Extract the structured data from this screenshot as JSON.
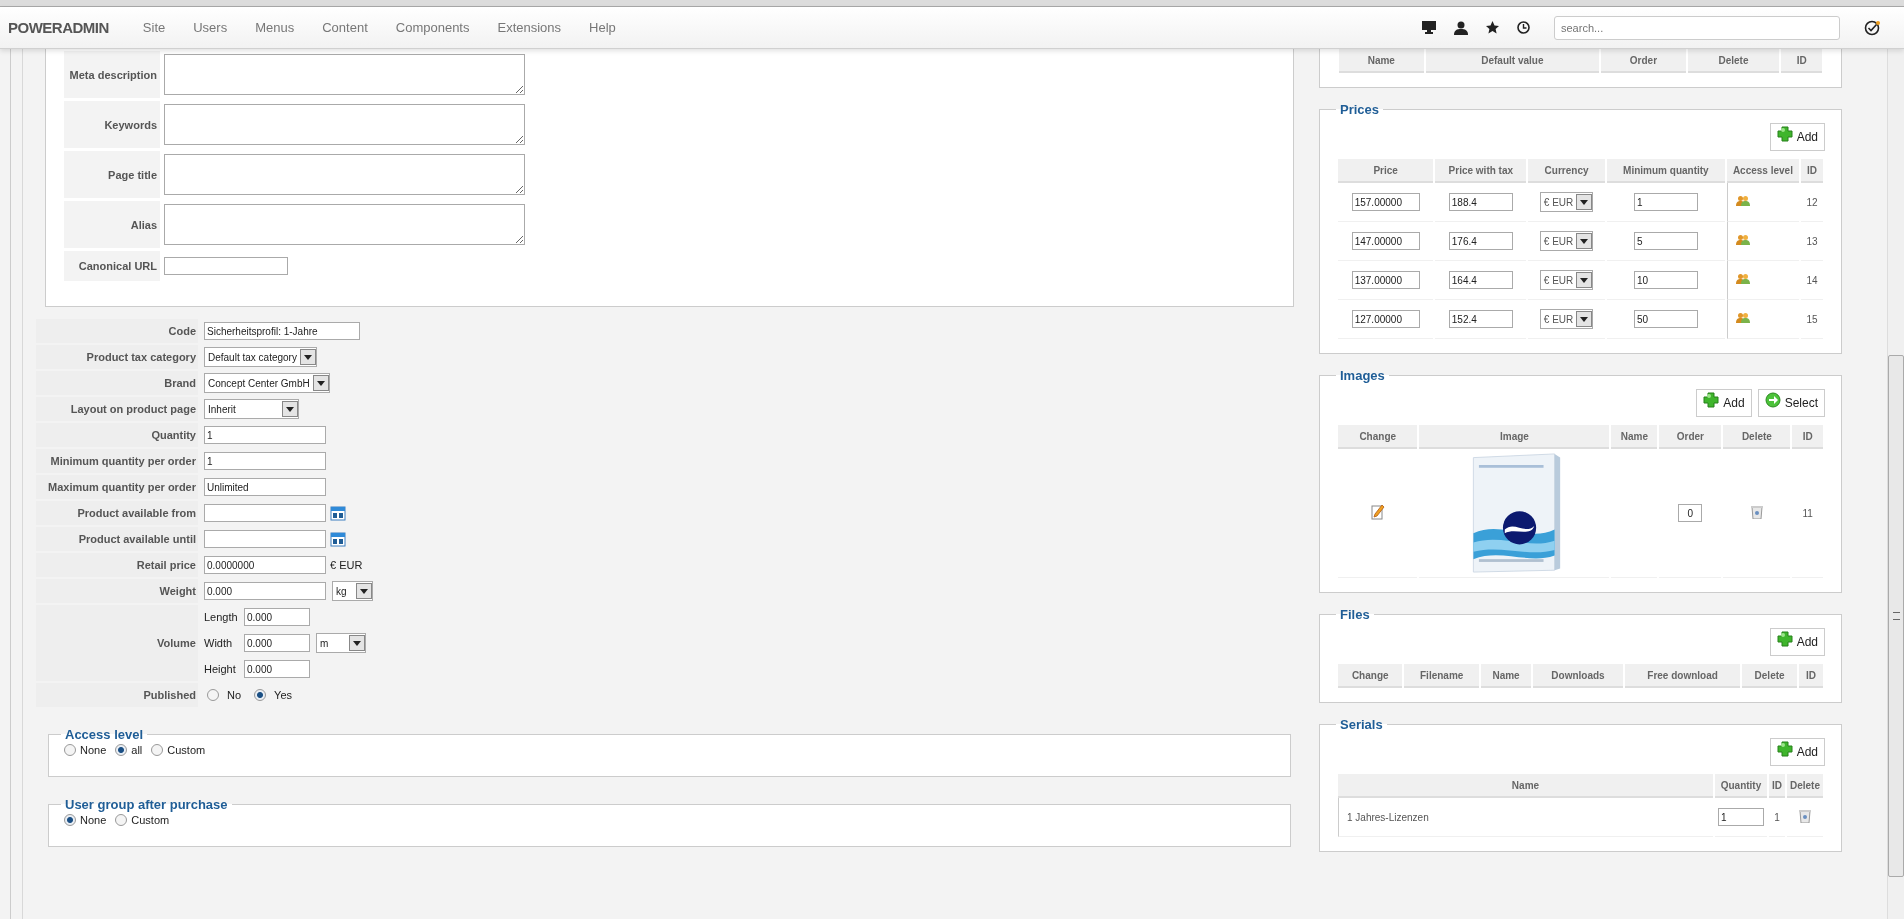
{
  "navbar": {
    "logo": "POWERADMIN",
    "menu": [
      "Site",
      "Users",
      "Menus",
      "Content",
      "Components",
      "Extensions",
      "Help"
    ],
    "search": {
      "placeholder": "search..."
    }
  },
  "meta_fields": [
    {
      "label": "Meta description",
      "kind": "textarea"
    },
    {
      "label": "Keywords",
      "kind": "textarea"
    },
    {
      "label": "Page title",
      "kind": "textarea"
    },
    {
      "label": "Alias",
      "kind": "textarea"
    },
    {
      "label": "Canonical URL",
      "kind": "text"
    }
  ],
  "product_fields": [
    {
      "label": "Code",
      "kind": "text",
      "value": "Sicherheitsprofil: 1-Jahre"
    },
    {
      "label": "Product tax category",
      "kind": "select",
      "value": "Default tax category"
    },
    {
      "label": "Brand",
      "kind": "select",
      "value": "Concept Center GmbH"
    },
    {
      "label": "Layout on product page",
      "kind": "select",
      "value": "Inherit"
    },
    {
      "label": "Quantity",
      "kind": "text",
      "value": "1"
    },
    {
      "label": "Minimum quantity per order",
      "kind": "text",
      "value": "1"
    },
    {
      "label": "Maximum quantity per order",
      "kind": "text",
      "value": "Unlimited"
    },
    {
      "label": "Product available from",
      "kind": "date"
    },
    {
      "label": "Product available until",
      "kind": "date"
    },
    {
      "label": "Retail price",
      "kind": "text",
      "value": "0.0000000",
      "suffix": "€ EUR"
    },
    {
      "label": "Weight",
      "kind": "text",
      "value": "0.000",
      "unit": "kg"
    },
    {
      "label": "Volume",
      "kind": "volume",
      "dims": [
        {
          "label": "Length",
          "value": "0.000"
        },
        {
          "label": "Width",
          "value": "0.000"
        },
        {
          "label": "Height",
          "value": "0.000"
        }
      ],
      "unit": "m"
    },
    {
      "label": "Published",
      "kind": "radio",
      "options": [
        {
          "label": "No",
          "selected": false
        },
        {
          "label": "Yes",
          "selected": true
        }
      ]
    }
  ],
  "access_level": {
    "title": "Access level",
    "options": [
      {
        "label": "None",
        "selected": false
      },
      {
        "label": "all",
        "selected": true
      },
      {
        "label": "Custom",
        "selected": false
      }
    ]
  },
  "user_group": {
    "title": "User group after purchase",
    "options": [
      {
        "label": "None",
        "selected": true
      },
      {
        "label": "Custom",
        "selected": false
      }
    ]
  },
  "attributes": {
    "columns": [
      "Name",
      "Default value",
      "Order",
      "Delete",
      "ID"
    ]
  },
  "prices": {
    "title": "Prices",
    "add_button": "Add",
    "columns": [
      "Price",
      "Price with tax",
      "Currency",
      "Minimum quantity",
      "Access level",
      "ID"
    ],
    "rows": [
      {
        "price": "157.00000",
        "price_with_tax": "188.4",
        "currency": "€ EUR",
        "minimum_quantity": "1",
        "id": "12"
      },
      {
        "price": "147.00000",
        "price_with_tax": "176.4",
        "currency": "€ EUR",
        "minimum_quantity": "5",
        "id": "13"
      },
      {
        "price": "137.00000",
        "price_with_tax": "164.4",
        "currency": "€ EUR",
        "minimum_quantity": "10",
        "id": "14"
      },
      {
        "price": "127.00000",
        "price_with_tax": "152.4",
        "currency": "€ EUR",
        "minimum_quantity": "50",
        "id": "15"
      }
    ]
  },
  "images": {
    "title": "Images",
    "buttons": [
      {
        "label": "Add",
        "kind": "add"
      },
      {
        "label": "Select",
        "kind": "select"
      }
    ],
    "columns": [
      "Change",
      "Image",
      "Name",
      "Order",
      "Delete",
      "ID"
    ],
    "rows": [
      {
        "order": "0",
        "id": "11"
      }
    ]
  },
  "files": {
    "title": "Files",
    "add_button": "Add",
    "columns": [
      "Change",
      "Filename",
      "Name",
      "Downloads",
      "Free download",
      "Delete",
      "ID"
    ]
  },
  "serials": {
    "title": "Serials",
    "add_button": "Add",
    "columns": [
      "Name",
      "Quantity",
      "ID",
      "Delete"
    ],
    "rows": [
      {
        "name": "1 Jahres-Lizenzen",
        "quantity": "1",
        "id": "1"
      }
    ]
  }
}
